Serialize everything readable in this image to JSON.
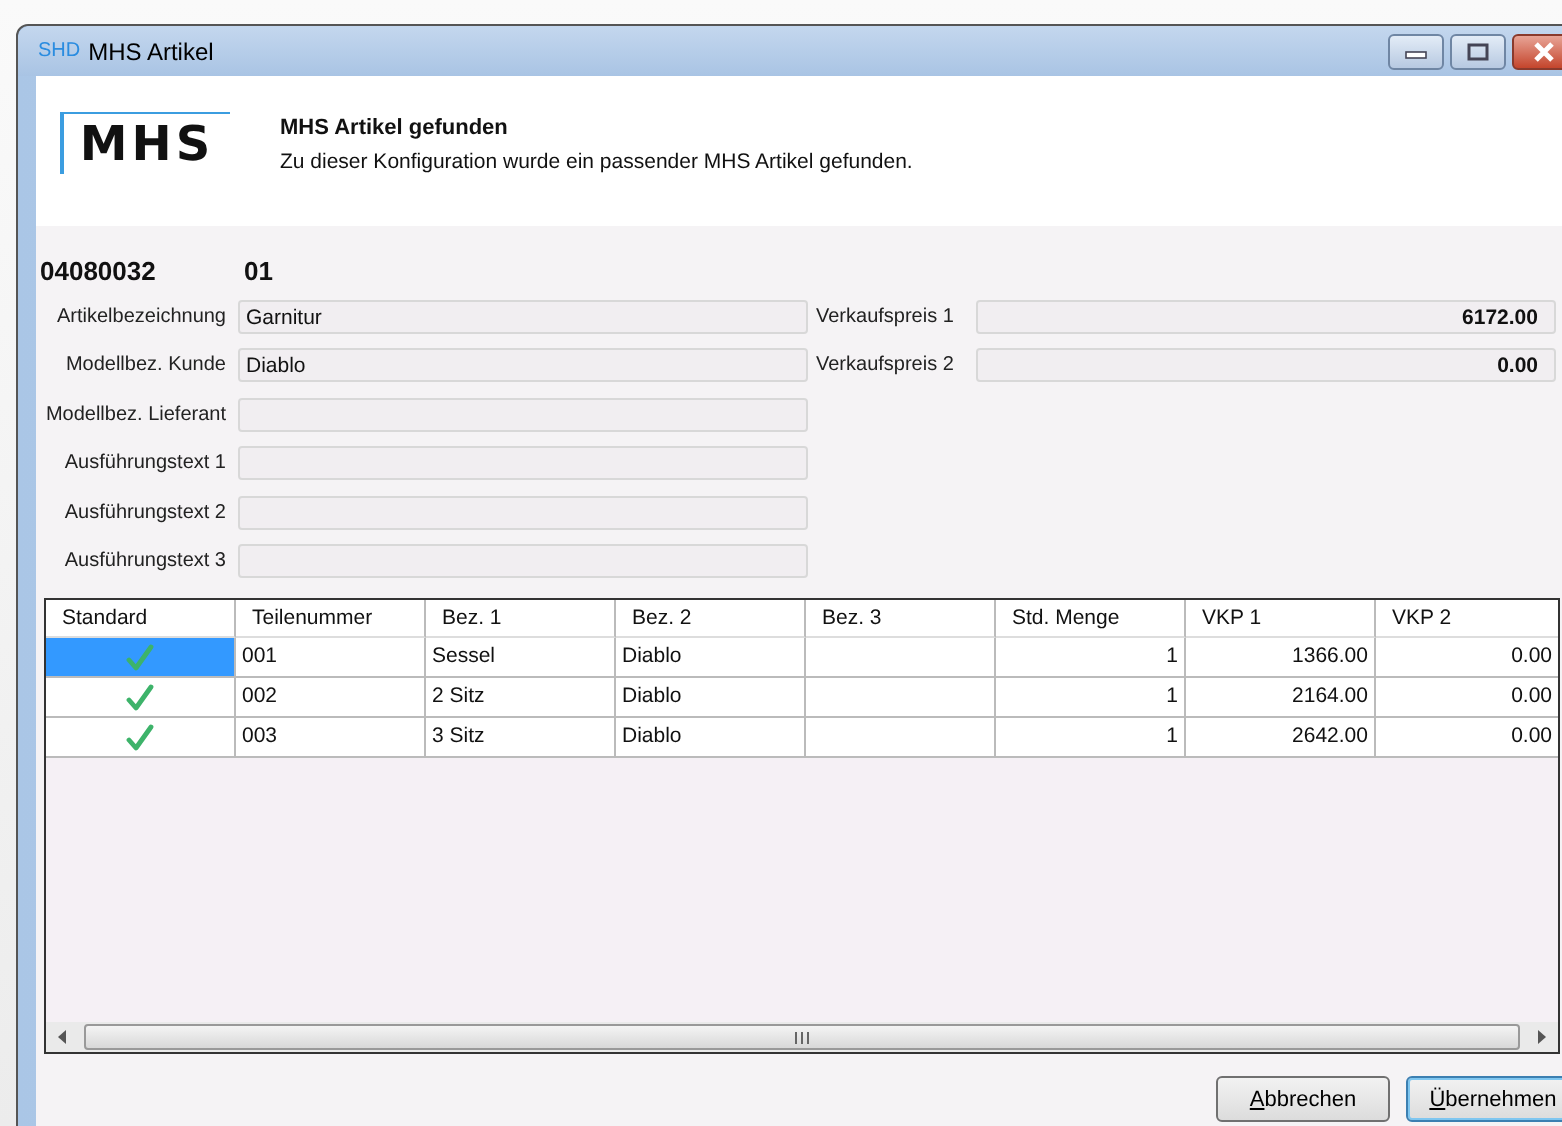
{
  "window": {
    "app_tag": "SHD",
    "title": "MHS Artikel"
  },
  "header": {
    "logo_text": "MHS",
    "title": "MHS Artikel gefunden",
    "message": "Zu dieser Konfiguration wurde ein passender MHS Artikel gefunden."
  },
  "article": {
    "number": "04080032",
    "variant": "01"
  },
  "fields": [
    {
      "label": "Artikelbezeichnung",
      "value": "Garnitur"
    },
    {
      "label": "Modellbez. Kunde",
      "value": "Diablo"
    },
    {
      "label": "Modellbez. Lieferant"
    },
    {
      "label": "Ausführungstext 1"
    },
    {
      "label": "Ausführungstext 2"
    },
    {
      "label": "Ausführungstext 3"
    }
  ],
  "prices": [
    {
      "label": "Verkaufspreis 1",
      "value": "6172.00"
    },
    {
      "label": "Verkaufspreis 2",
      "value": "0.00"
    }
  ],
  "table": {
    "columns": [
      "Standard",
      "Teilenummer",
      "Bez. 1",
      "Bez. 2",
      "Bez. 3",
      "Std. Menge",
      "VKP 1",
      "VKP 2"
    ],
    "rows": [
      {
        "standard": true,
        "selected": true,
        "cells": [
          "",
          "001",
          "Sessel",
          "Diablo",
          "",
          "1",
          "1366.00",
          "0.00"
        ]
      },
      {
        "standard": true,
        "selected": false,
        "cells": [
          "",
          "002",
          "2 Sitz",
          "Diablo",
          "",
          "1",
          "2164.00",
          "0.00"
        ]
      },
      {
        "standard": true,
        "selected": false,
        "cells": [
          "",
          "003",
          "3 Sitz",
          "Diablo",
          "",
          "1",
          "2642.00",
          "0.00"
        ]
      }
    ]
  },
  "buttons": [
    {
      "label": "Abbrechen",
      "default": false
    },
    {
      "label": "Übernehmen",
      "default": true
    }
  ]
}
